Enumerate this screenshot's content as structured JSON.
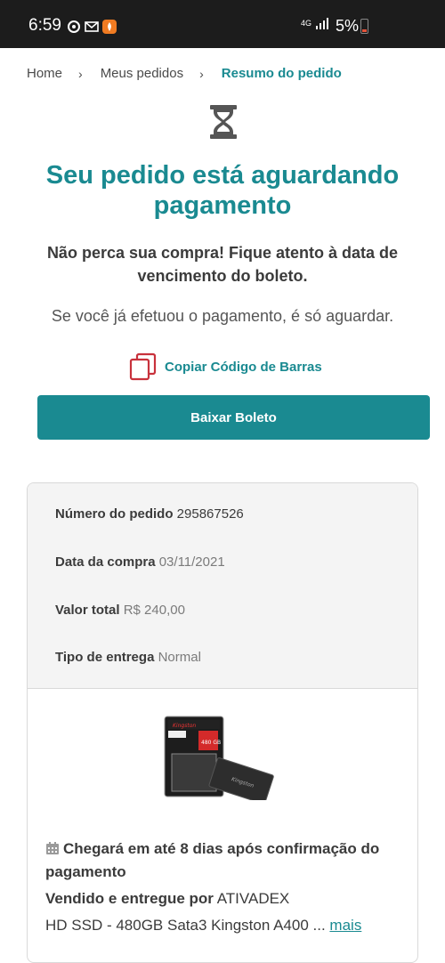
{
  "status_bar": {
    "time": "6:59",
    "network": "4G",
    "battery": "5%"
  },
  "breadcrumb": {
    "home": "Home",
    "orders": "Meus pedidos",
    "current": "Resumo do pedido"
  },
  "header": {
    "title": "Seu pedido está aguardando pagamento",
    "subtitle": "Não perca sua compra! Fique atento à data de vencimento do boleto.",
    "note": "Se você já efetuou o pagamento, é só aguardar."
  },
  "actions": {
    "copy_barcode": "Copiar Código de Barras",
    "download_boleto": "Baixar Boleto"
  },
  "order": {
    "number_label": "Número do pedido",
    "number_value": "295867526",
    "date_label": "Data da compra",
    "date_value": "03/11/2021",
    "total_label": "Valor total",
    "total_value": "R$ 240,00",
    "delivery_label": "Tipo de entrega",
    "delivery_value": "Normal"
  },
  "product": {
    "delivery_estimate": "Chegará em até 8 dias após confirmação do pagamento",
    "seller_label": "Vendido e entregue por",
    "seller_value": "ATIVADEX",
    "name": "HD SSD - 480GB Sata3 Kingston A400 ...",
    "more_link": "mais",
    "brand": "Kingston",
    "capacity": "480 GB"
  },
  "colors": {
    "accent": "#1a8a91",
    "copy_icon": "#c8323c"
  },
  "icons": {
    "hourglass": "hourglass-icon",
    "copy": "copy-icon",
    "calendar": "calendar-icon",
    "breadcrumb_separator": "chevron-right-icon"
  }
}
